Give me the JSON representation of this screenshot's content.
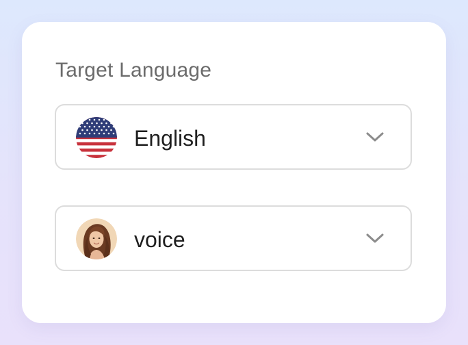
{
  "section": {
    "title": "Target Language"
  },
  "language_select": {
    "value": "English",
    "flag_icon": "us-flag-icon",
    "dropdown_icon": "chevron-down-icon"
  },
  "voice_select": {
    "value": "voice",
    "avatar": "woman-avatar",
    "dropdown_icon": "chevron-down-icon"
  },
  "colors": {
    "background_top": "#dde8fd",
    "background_bottom": "#e9e1fb",
    "card": "#ffffff",
    "title_text": "#6b6b6b",
    "value_text": "#1f1f1f",
    "border": "#dcdcdc",
    "chevron": "#8c8c8c"
  }
}
